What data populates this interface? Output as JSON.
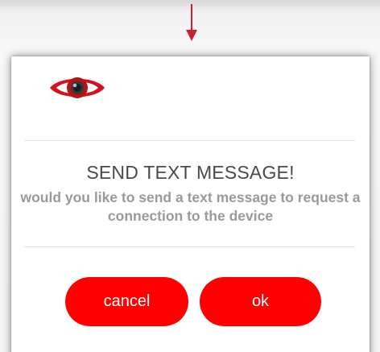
{
  "dialog": {
    "icon": "eye-icon",
    "title": "SEND TEXT MESSAGE!",
    "message": "would you like to send a text message to request a connection to the device",
    "buttons": {
      "cancel_label": "cancel",
      "ok_label": "ok"
    }
  },
  "colors": {
    "accent": "#ff0000",
    "arrow": "#cc1f2f",
    "title_text": "#4a4a4a",
    "message_text": "#9a9a9a"
  },
  "icons": {
    "arrow": "arrow-down-icon",
    "eye": "eye-icon"
  }
}
